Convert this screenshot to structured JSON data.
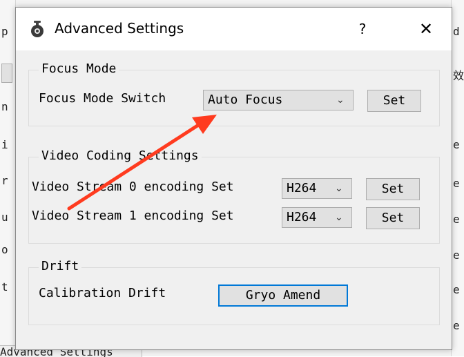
{
  "dialog": {
    "title": "Advanced Settings",
    "help_label": "?",
    "close_label": "✕"
  },
  "focus_group": {
    "title": "Focus Mode",
    "switch_label": "Focus Mode Switch",
    "selected": "Auto Focus",
    "set_label": "Set"
  },
  "video_group": {
    "title": "Video Coding Settings",
    "rows": [
      {
        "label": "Video Stream 0 encoding Set",
        "selected": "H264",
        "set_label": "Set"
      },
      {
        "label": "Video Stream 1 encoding Set",
        "selected": "H264",
        "set_label": "Set"
      }
    ]
  },
  "drift_group": {
    "title": "Drift",
    "label": "Calibration Drift",
    "button_label": "Gryo Amend"
  },
  "background": {
    "left_fragments": [
      "p",
      "n",
      "i",
      "r",
      "u",
      "o",
      "t"
    ],
    "right_fragments": [
      "d",
      "效",
      "e",
      "e",
      "e",
      "e",
      "e",
      "e"
    ],
    "bottom_tab": "Advanced Settings"
  },
  "colors": {
    "annotation_arrow": "#ff3b1f",
    "focus_border": "#0078d7"
  },
  "icons": {
    "app_icon": "gear-icon",
    "chevron": "chevron-down-icon"
  }
}
